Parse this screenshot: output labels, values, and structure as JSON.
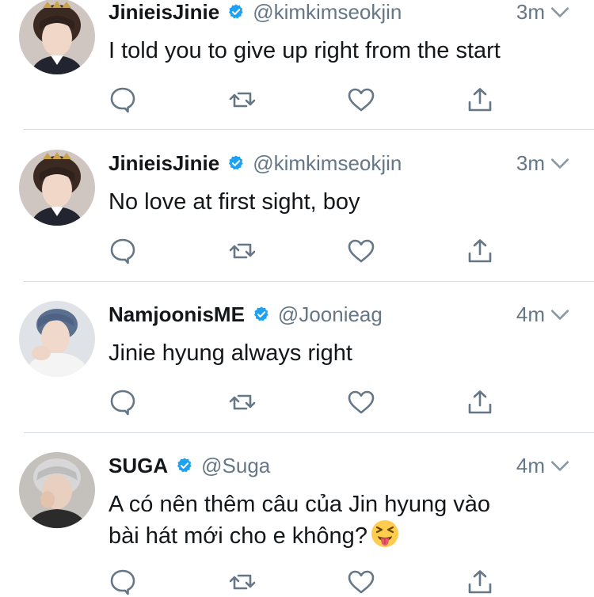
{
  "tweets": [
    {
      "display_name": "JinieisJinie",
      "handle": "@kimkimseokjin",
      "time": "3m",
      "text": "I told you to give up right from the start",
      "avatar": "jin-avatar"
    },
    {
      "display_name": "JinieisJinie",
      "handle": "@kimkimseokjin",
      "time": "3m",
      "text": "No love at first sight, boy",
      "avatar": "jin-avatar"
    },
    {
      "display_name": "NamjoonisME",
      "handle": "@Joonieag",
      "time": "4m",
      "text": "Jinie hyung always right",
      "avatar": "namjoon-avatar"
    },
    {
      "display_name": "SUGA",
      "handle": "@Suga",
      "time": "4m",
      "text_line1": "A có nên thêm câu của Jin hyung vào",
      "text_line2": "bài hát mới cho e không?",
      "emoji": "squinting-face-with-tongue",
      "avatar": "suga-avatar"
    }
  ],
  "icons": {
    "reply": "reply-icon",
    "retweet": "retweet-icon",
    "like": "heart-icon",
    "share": "share-icon",
    "verified": "verified-badge-icon",
    "caret": "chevron-down-icon"
  },
  "colors": {
    "verified": "#1da1f2",
    "icon_gray": "#657786",
    "text": "#14171a",
    "divider": "#d6dbe0"
  }
}
